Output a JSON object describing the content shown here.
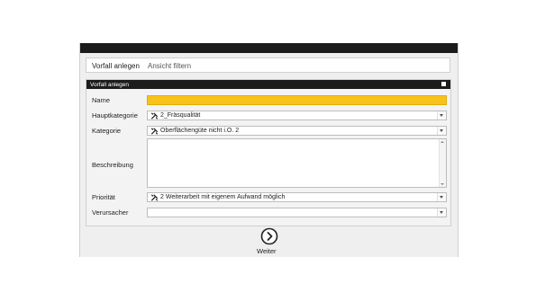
{
  "tabs": [
    {
      "label": "Vorfall anlegen"
    },
    {
      "label": "Ansicht filtern"
    }
  ],
  "panel": {
    "title": "Vorfall anlegen",
    "fields": {
      "name": {
        "label": "Name",
        "value": ""
      },
      "hauptkategorie": {
        "label": "Hauptkategorie",
        "value": "2_Fräsqualität"
      },
      "kategorie": {
        "label": "Kategorie",
        "value": "Oberflächengüte nicht i.O. 2"
      },
      "beschreibung": {
        "label": "Beschreibung",
        "value": ""
      },
      "prioritaet": {
        "label": "Priorität",
        "value": "2 Weiterarbeit mit eigenem Aufwand möglich"
      },
      "verursacher": {
        "label": "Verursacher",
        "value": ""
      }
    }
  },
  "next": {
    "label": "Weiter"
  },
  "colors": {
    "accent_yellow": "#f7c21a",
    "dark_bar": "#1b1b1b"
  },
  "icons": {
    "field_icon": "tools-icon",
    "next_icon": "chevron-right-circle-icon"
  }
}
